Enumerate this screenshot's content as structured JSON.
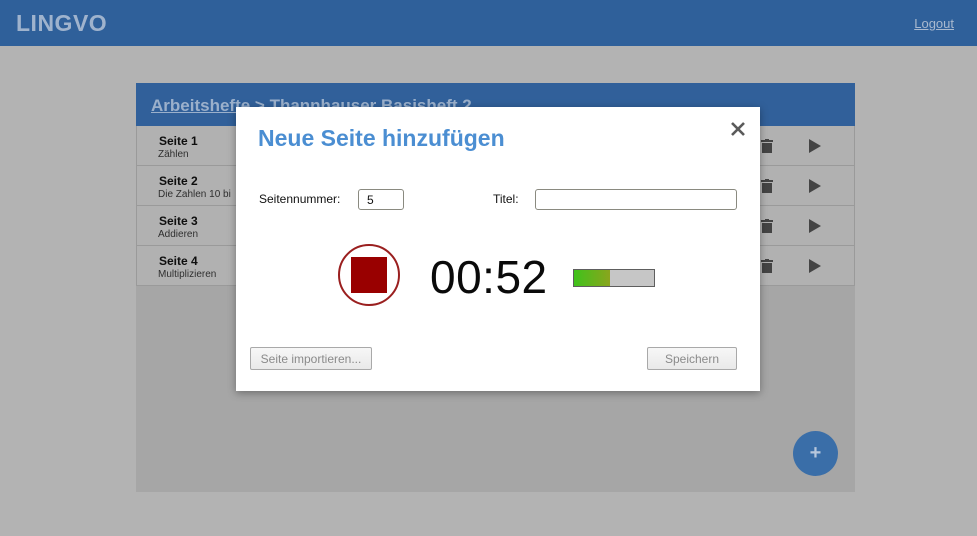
{
  "app": {
    "logo": "LINGVO",
    "logout_label": "Logout"
  },
  "breadcrumb": {
    "parent": "Arbeitshefte",
    "separator": " > ",
    "current": "Thannhauser Basisheft 2"
  },
  "pages": [
    {
      "title": "Seite 1",
      "subtitle": "Zählen"
    },
    {
      "title": "Seite 2",
      "subtitle": "Die Zahlen 10 bi"
    },
    {
      "title": "Seite 3",
      "subtitle": "Addieren"
    },
    {
      "title": "Seite 4",
      "subtitle": "Multiplizieren"
    }
  ],
  "fab": {
    "label": "+"
  },
  "modal": {
    "title": "Neue Seite hinzufügen",
    "close_icon": "close-icon",
    "page_number_label": "Seitennummer:",
    "page_number_value": "5",
    "title_label": "Titel:",
    "title_value": "",
    "timer": "00:52",
    "level_fraction": 0.45,
    "import_label": "Seite importieren...",
    "save_label": "Speichern"
  },
  "colors": {
    "header_blue": "#2f609a",
    "title_blue": "#4b8ed2",
    "record_red": "#990000",
    "level_green": "#3fc21b"
  }
}
